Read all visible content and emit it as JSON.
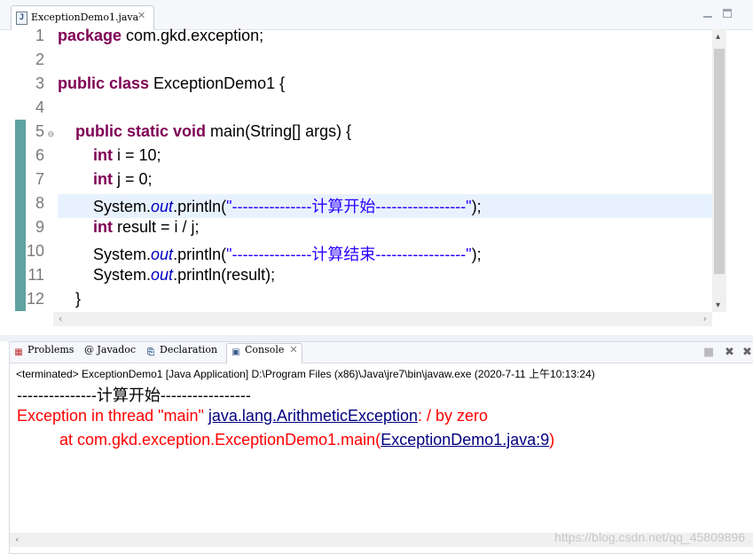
{
  "editor": {
    "tab_icon": "J",
    "tab_label": "ExceptionDemo1.java",
    "tab_close": "✕",
    "line_numbers": [
      "1",
      "2",
      "3",
      "4",
      "5",
      "6",
      "7",
      "8",
      "9",
      "10",
      "11",
      "12"
    ]
  },
  "code": {
    "line1": {
      "kw": "package",
      "rest": " com.gkd.exception;"
    },
    "line3": {
      "kw": "public class",
      "rest": " ExceptionDemo1 {"
    },
    "line5": {
      "indent": "    ",
      "kw": "public static void",
      "rest": " main(String[] args) {"
    },
    "line6": {
      "indent": "        ",
      "kw": "int",
      "rest": " i = 10;"
    },
    "line7": {
      "indent": "        ",
      "kw": "int",
      "rest": " j = 0;"
    },
    "line8": {
      "indent": "        ",
      "pre": "System.",
      "fld": "out",
      "mid": ".println(",
      "str": "\"---------------计算开始-----------------\"",
      "post": ");"
    },
    "line9": {
      "indent": "        ",
      "kw": "int",
      "rest": " result = i / j;"
    },
    "line10": {
      "indent": "        ",
      "pre": "System.",
      "fld": "out",
      "mid": ".println(",
      "str": "\"---------------计算结束-----------------\"",
      "post": ");"
    },
    "line11": {
      "indent": "        ",
      "pre": "System.",
      "fld": "out",
      "mid": ".println(result);"
    },
    "line12": {
      "indent": "    ",
      "text": "}"
    }
  },
  "panel": {
    "tabs": [
      {
        "icon": "problems-icon",
        "label": "Problems"
      },
      {
        "icon": "javadoc-icon",
        "label": "@ Javadoc"
      },
      {
        "icon": "declaration-icon",
        "label": "Declaration"
      },
      {
        "icon": "console-icon",
        "label": "Console"
      }
    ],
    "status": "<terminated> ExceptionDemo1 [Java Application] D:\\Program Files (x86)\\Java\\jre7\\bin\\javaw.exe (2020-7-11 上午10:13:24)",
    "output": {
      "line1": "---------------计算开始-----------------",
      "line2_pre": "Exception in thread \"main\" ",
      "line2_link": "java.lang.ArithmeticException",
      "line2_post": ": / by zero",
      "line3_pre": "\tat com.gkd.exception.ExceptionDemo1.main(",
      "line3_link": "ExceptionDemo1.java:9",
      "line3_post": ")"
    }
  },
  "watermark": "https://blog.csdn.net/qq_45809896"
}
